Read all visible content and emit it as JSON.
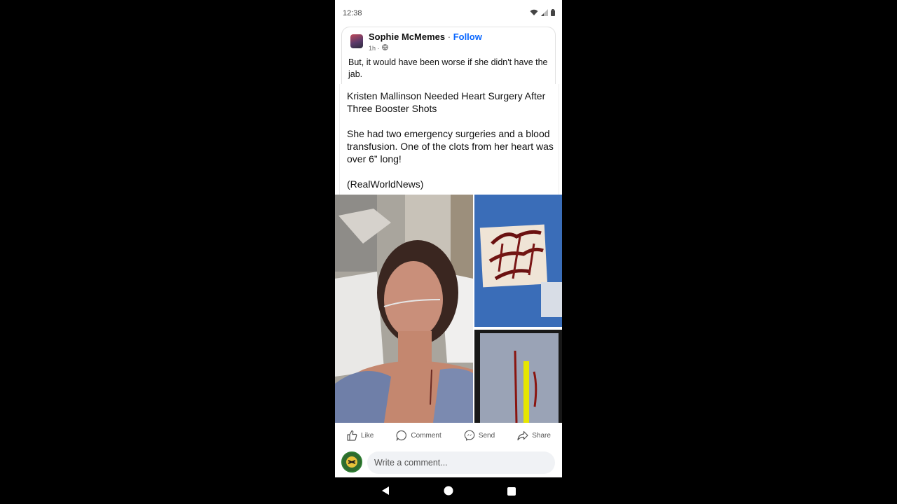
{
  "status_bar": {
    "time": "12:38"
  },
  "post": {
    "author": "Sophie McMemes",
    "separator": "·",
    "follow_label": "Follow",
    "timestamp": "1h ·",
    "caption": "But, it would have been worse if she didn't have the jab."
  },
  "article": {
    "title": "Kristen Mallinson Needed Heart Surgery After Three Booster Shots",
    "body": "She had two emergency surgeries and a blood transfusion. One of the clots from her heart was over 6” long!",
    "source": "(RealWorldNews)"
  },
  "actions": {
    "like": "Like",
    "comment": "Comment",
    "send": "Send",
    "share": "Share"
  },
  "comment_box": {
    "placeholder": "Write a comment..."
  },
  "icons": {
    "wifi": "wifi-icon",
    "signal": "signal-icon",
    "battery": "battery-icon",
    "globe": "globe-icon",
    "like": "thumbs-up-icon",
    "comment": "comment-bubble-icon",
    "send": "messenger-icon",
    "share": "share-arrow-icon",
    "back": "back-triangle-icon",
    "home": "home-circle-icon",
    "recents": "recents-square-icon"
  },
  "colors": {
    "follow": "#0866ff",
    "background": "#000000"
  }
}
